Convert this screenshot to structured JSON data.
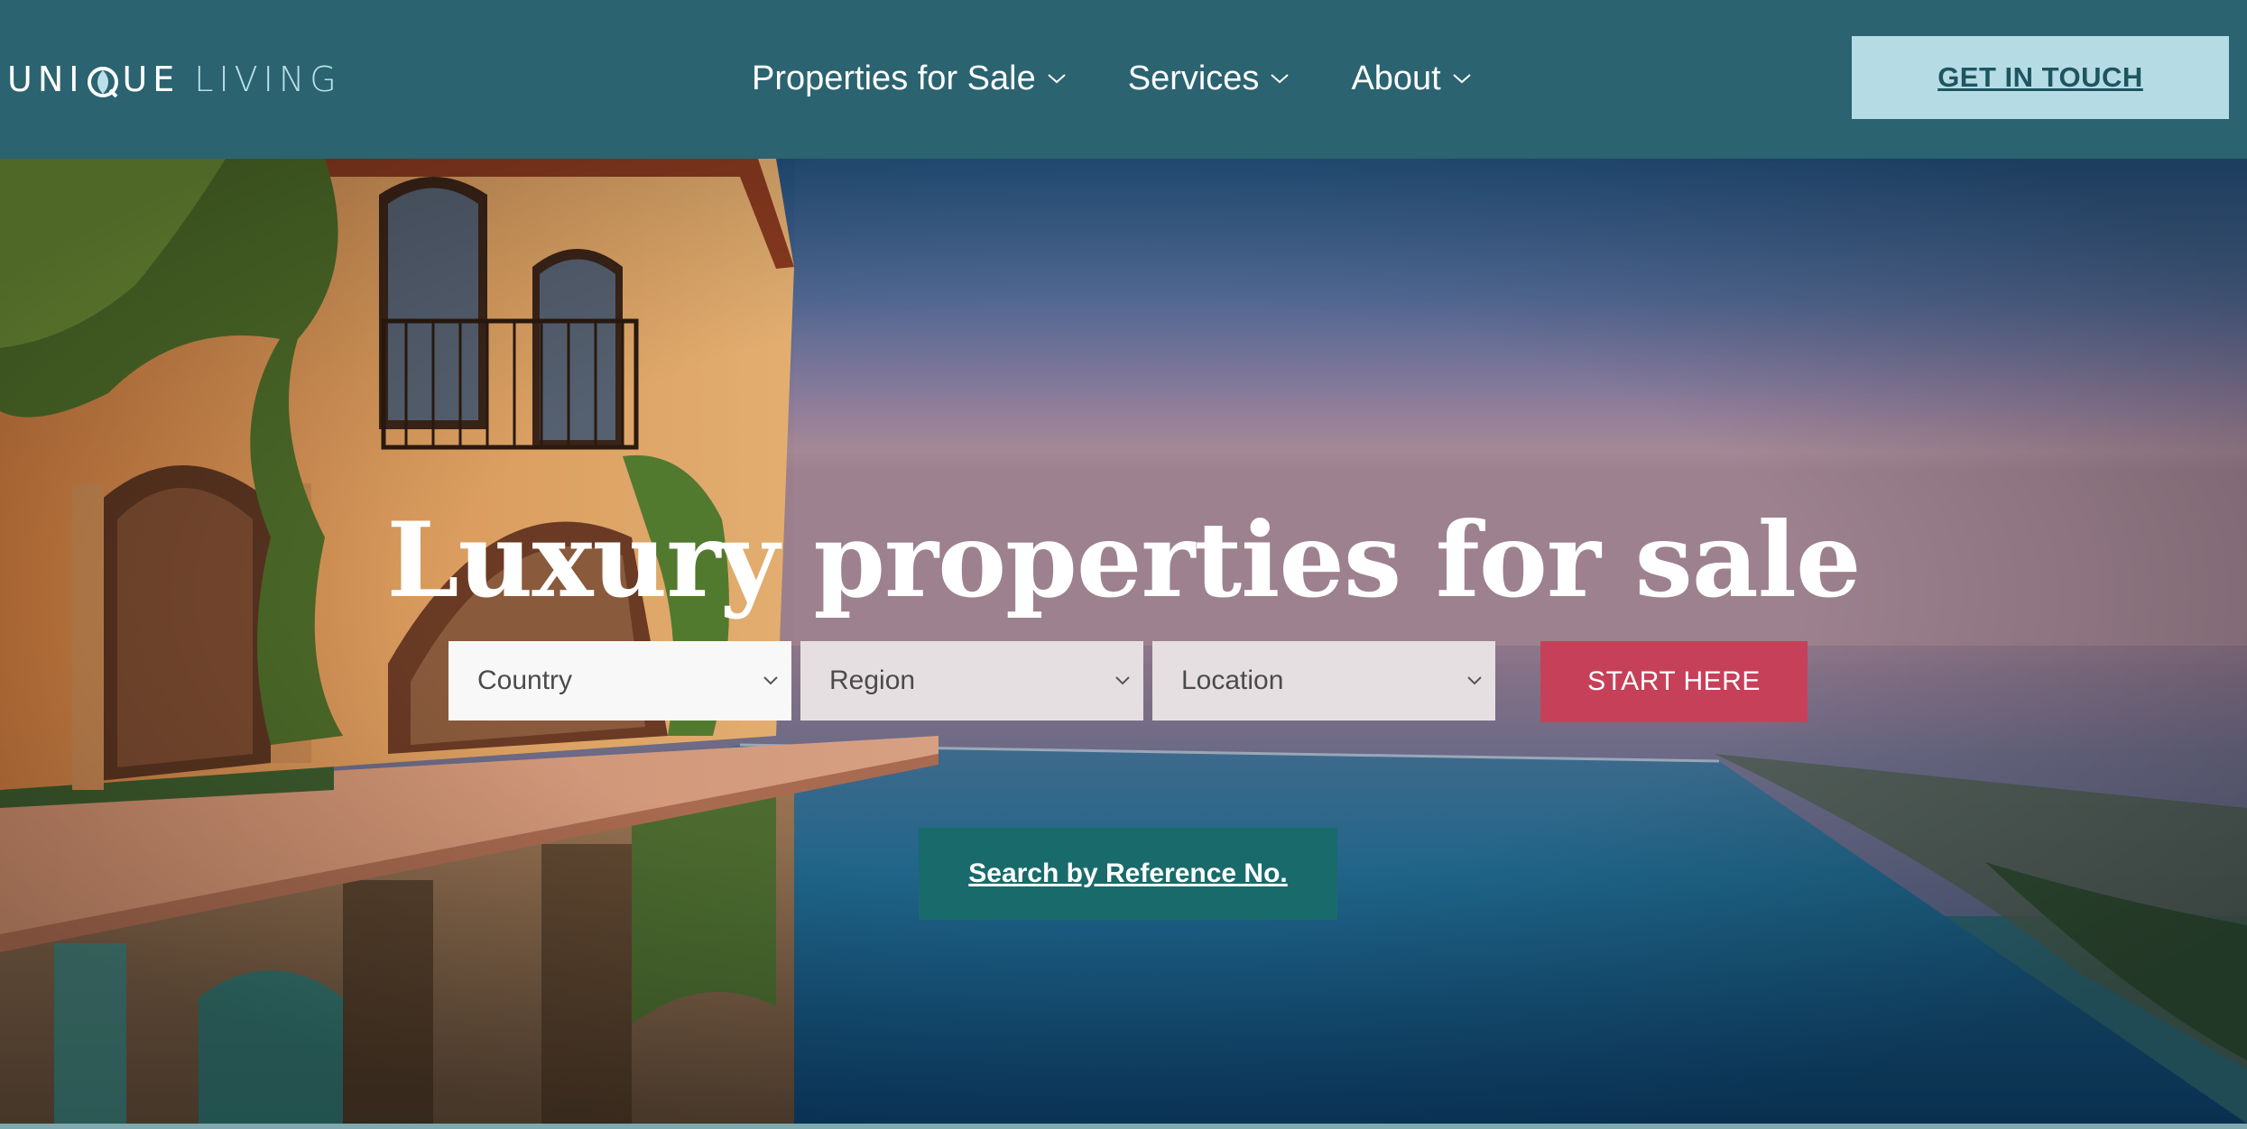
{
  "logo": {
    "word1": "UNIQUE",
    "word2": "LIVING",
    "icon": "logo-q-leaf-icon"
  },
  "nav": {
    "items": [
      {
        "label": "Properties for Sale",
        "icon": "chevron-down-icon"
      },
      {
        "label": "Services",
        "icon": "chevron-down-icon"
      },
      {
        "label": "About",
        "icon": "chevron-down-icon"
      }
    ],
    "cta_label": "GET IN TOUCH"
  },
  "hero": {
    "title": "Luxury properties for sale",
    "filters": {
      "country": "Country",
      "region": "Region",
      "location": "Location"
    },
    "start_label": "START HERE",
    "reference_label": "Search by Reference No."
  },
  "colors": {
    "header_bg": "#2b6370",
    "cta_bg": "#b5dce5",
    "start_bg": "#c7405a",
    "reference_bg": "#196b6b"
  }
}
